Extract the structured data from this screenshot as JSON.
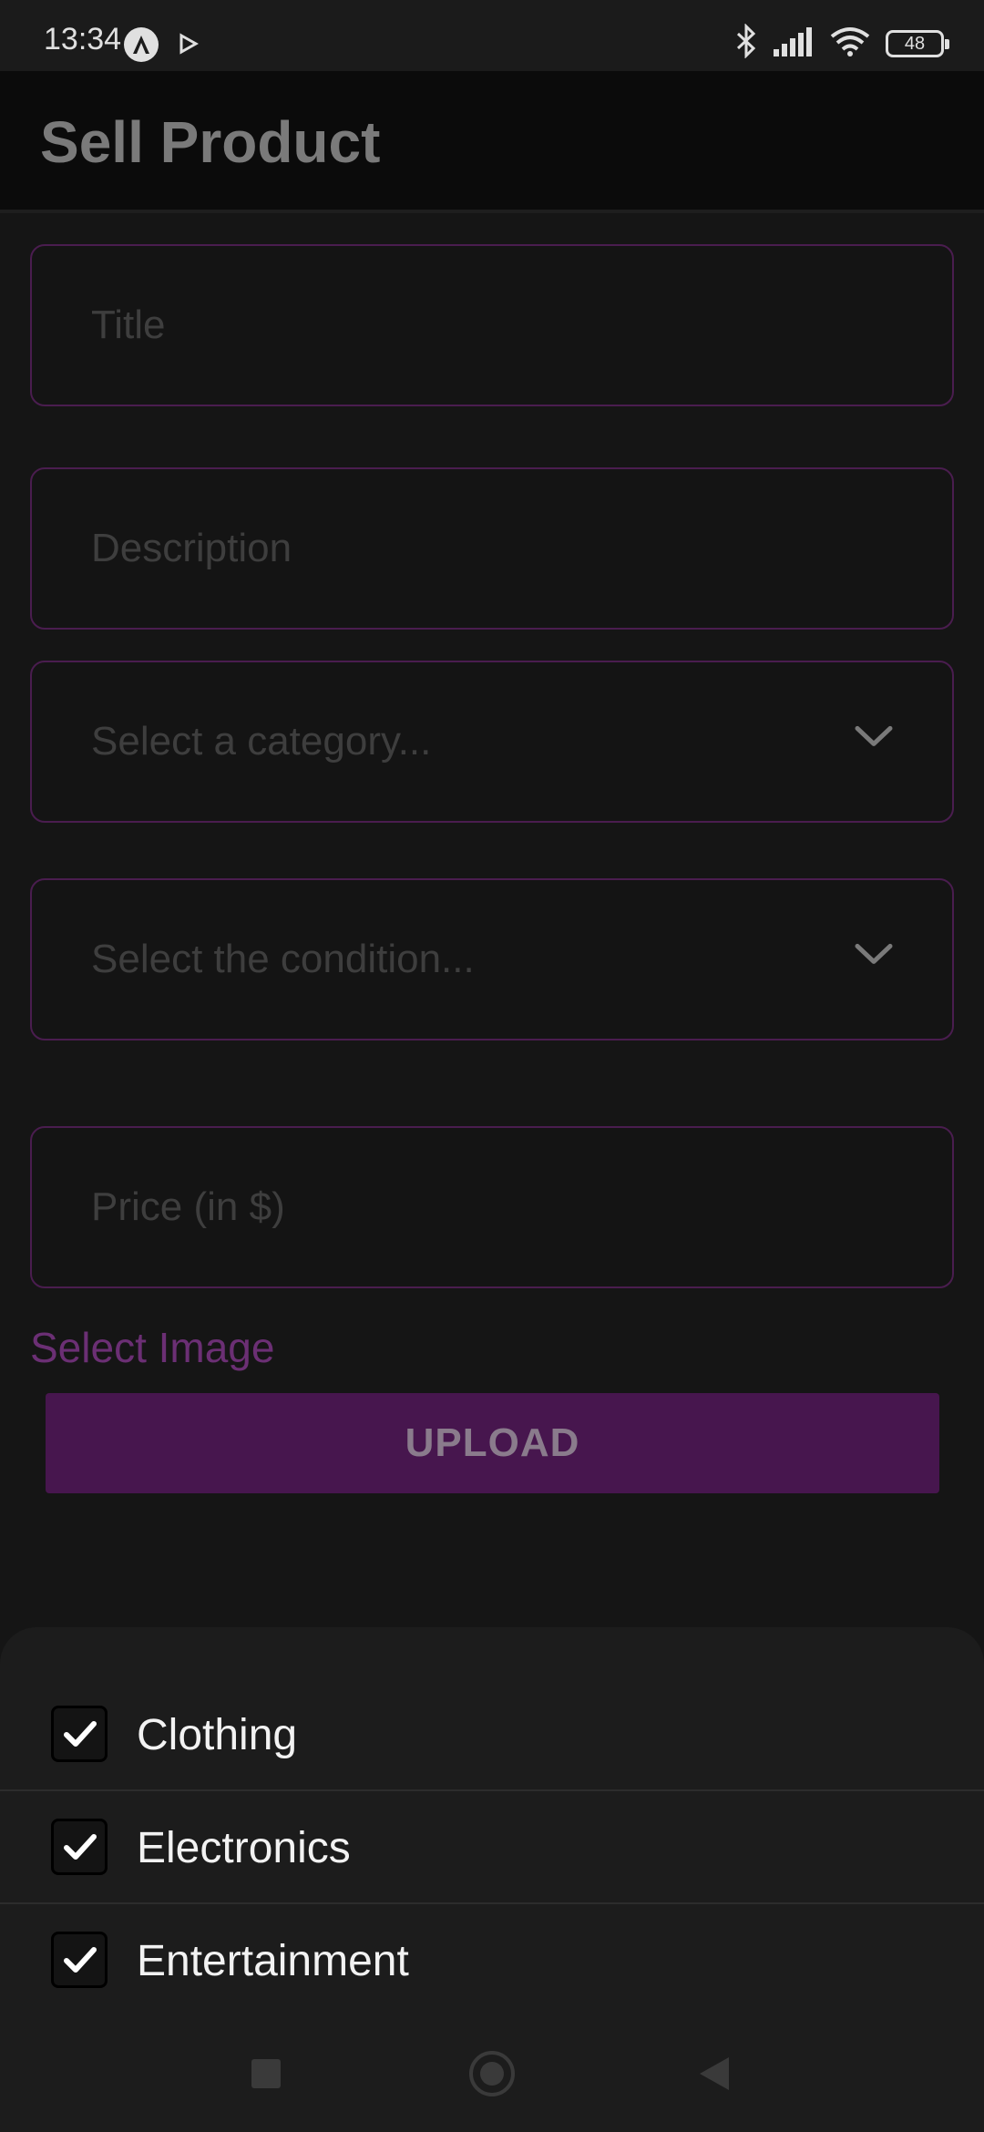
{
  "status_bar": {
    "time": "13:34",
    "battery": "48",
    "icons": [
      "notification-a-icon",
      "play-icon",
      "bluetooth-icon",
      "signal-icon",
      "wifi-icon",
      "battery-icon"
    ]
  },
  "app_bar": {
    "title": "Sell Product"
  },
  "form": {
    "title_placeholder": "Title",
    "description_placeholder": "Description",
    "category_placeholder": "Select a category...",
    "condition_placeholder": "Select the condition...",
    "price_placeholder": "Price (in $)",
    "select_image_label": "Select Image",
    "upload_label": "UPLOAD"
  },
  "category_sheet": {
    "items": [
      {
        "label": "Clothing",
        "checked": true
      },
      {
        "label": "Electronics",
        "checked": true
      },
      {
        "label": "Entertainment",
        "checked": true
      }
    ]
  },
  "nav_bar": {
    "icons": [
      "recents-icon",
      "home-icon",
      "back-icon"
    ]
  },
  "colors": {
    "accent": "#6b2f74",
    "field_border": "#4a1d4f",
    "button_bg": "#47164e",
    "background": "#151515"
  }
}
